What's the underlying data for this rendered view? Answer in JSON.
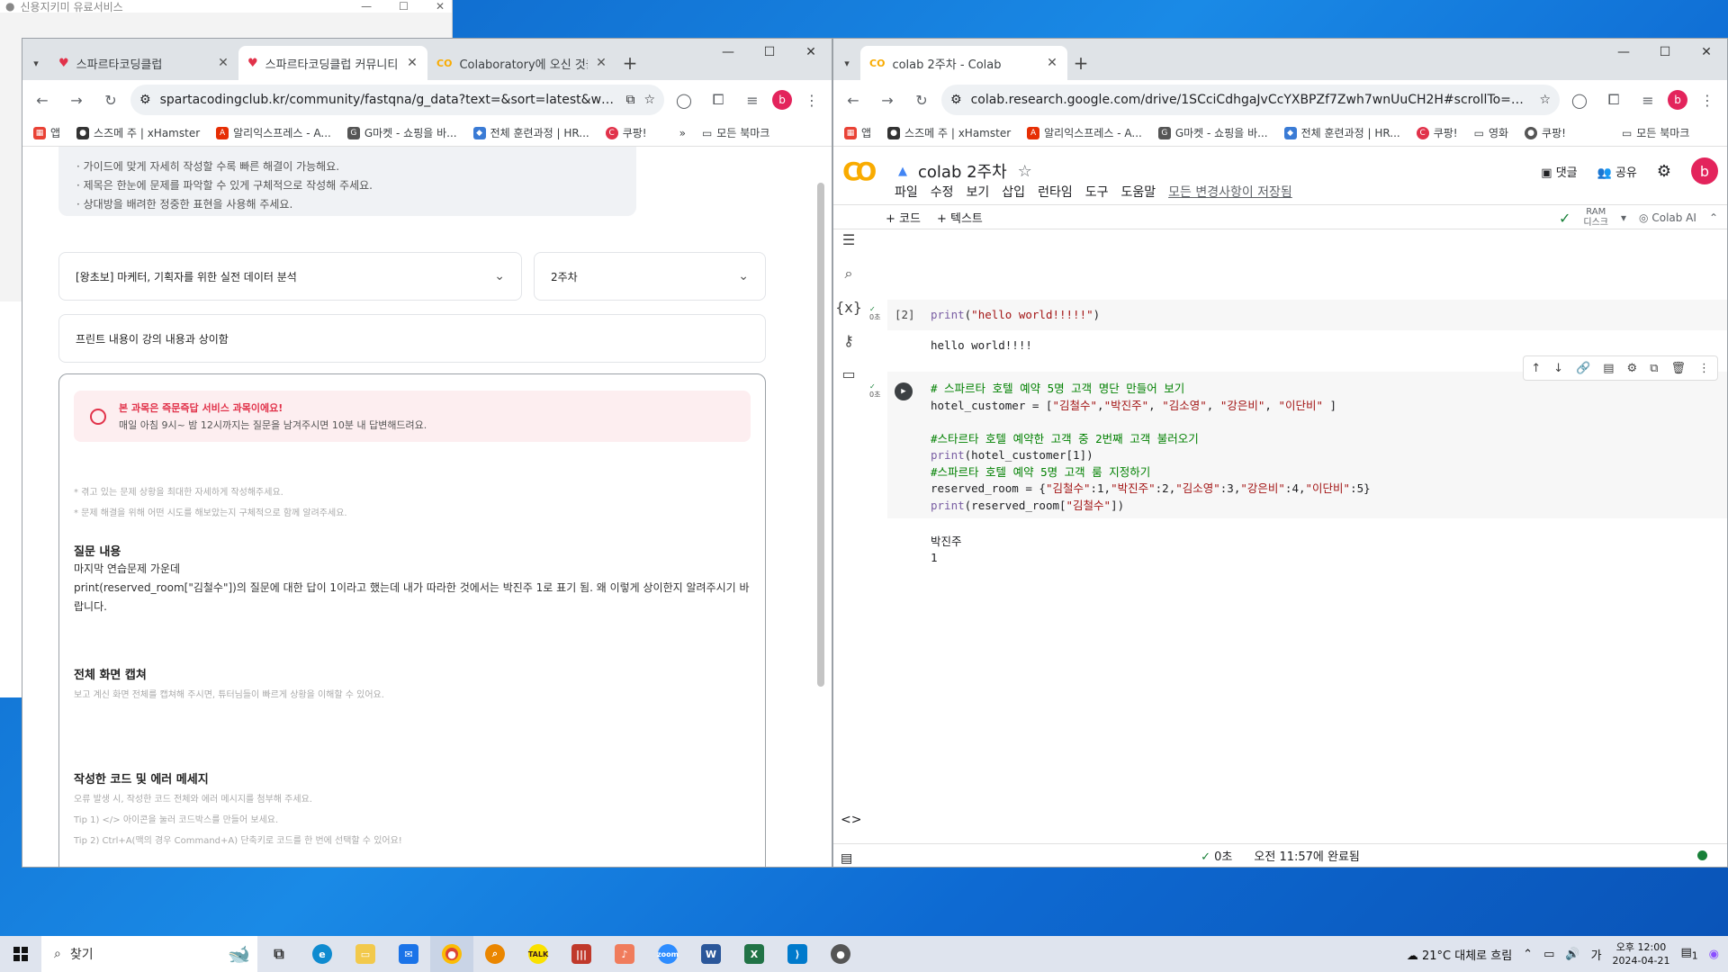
{
  "background_window": {
    "title": "신용지키미 유료서비스"
  },
  "left_browser": {
    "tabs": [
      {
        "label": "스파르타코딩클럽",
        "active": false
      },
      {
        "label": "스파르타코딩클럽 커뮤니티",
        "active": true
      },
      {
        "label": "Colaboratory에 오신 것을",
        "active": false
      }
    ],
    "url": "spartacodingclub.kr/community/fastqna/g_data?text=&sort=latest&wee...",
    "bookmarks": [
      "앱",
      "스즈메 주 | xHamster",
      "알리익스프레스 - A...",
      "G마켓 - 쇼핑을 바...",
      "전체 훈련과정 | HR...",
      "쿠팡!"
    ],
    "bookmarks_more": "»",
    "all_bookmarks": "모든 북마크",
    "guide_lines": [
      "· 가이드에 맞게 자세히 작성할 수록 빠른 해결이 가능해요.",
      "· 제목은 한눈에 문제를 파악할 수 있게 구체적으로 작성해 주세요.",
      "· 상대방을 배려한 정중한 표현을 사용해 주세요."
    ],
    "course_select": "[왕초보] 마케터, 기획자를 위한 실전 데이터 분석",
    "week_select": "2주차",
    "title_value": "프린트 내용이 강의 내용과 상이함",
    "notice_title": "본 과목은 즉문즉답 서비스 과목이에요!",
    "notice_desc": "매일 아침 9시~ 밤 12시까지는 질문을 남겨주시면 10분 내 답변해드려요.",
    "hint1": "* 겪고 있는 문제 상황을 최대한 자세하게 작성해주세요.",
    "hint2": "* 문제 해결을 위해 어떤 시도를 해보았는지 구체적으로 함께 알려주세요.",
    "q_heading": "질문 내용",
    "q_line1": "마지막 연습문제 가운데",
    "q_line2": "print(reserved_room[\"김철수\"])의 질문에 대한 답이 1이라고 했는데 내가 따라한 것에서는 박진주 1로 표기 됨. 왜 이렇게 상이한지 알려주시기 바랍니다.",
    "capture_heading": "전체 화면 캡쳐",
    "capture_hint": "보고 계신 화면 전체를 캡쳐해 주시면, 튜터님들이 빠르게 상황을 이해할 수 있어요.",
    "code_heading": "작성한 코드 및 에러 메세지",
    "code_hint1": "오류 발생 시, 작성한 코드 전체와 에러 메시지를 첨부해 주세요.",
    "code_hint2": "Tip 1) </> 아이콘을 눌러 코드박스를 만들어 보세요.",
    "code_hint3": "Tip 2) Ctrl+A(맥의 경우 Command+A) 단축키로 코드를 한 번에 선택할 수 있어요!"
  },
  "right_browser": {
    "tab": "colab 2주차 - Colab",
    "url": "colab.research.google.com/drive/1SCciCdhgaJvCcYXBPZf7Zwh7wnUuCH2H#scrollTo=Snae6zNS...",
    "bookmarks": [
      "앱",
      "스즈메 주 | xHamster",
      "알리익스프레스 - A...",
      "G마켓 - 쇼핑을 바...",
      "전체 훈련과정 | HR...",
      "쿠팡!",
      "영화",
      "쿠팡!"
    ],
    "all_bookmarks": "모든 북마크",
    "colab": {
      "logo": "CO",
      "notebook_title": "colab 2주차",
      "menu": [
        "파일",
        "수정",
        "보기",
        "삽입",
        "런타임",
        "도구",
        "도움말"
      ],
      "saved_status": "모든 변경사항이 저장됨",
      "comment": "댓글",
      "share": "공유",
      "add_code": "+ 코드",
      "add_text": "+ 텍스트",
      "ram": "RAM",
      "disk": "디스크",
      "colab_ai": "Colab AI",
      "cell1_exec": "[2]",
      "cell1_time": "0초",
      "cell1_code": "print(\"hello world!!!!!\")",
      "cell1_output": "hello world!!!!",
      "cell2_time": "0초",
      "cell2_output_line1": "박진주",
      "cell2_output_line2": "1",
      "status_time": "0초",
      "status_done": "오전 11:57에 완료됨"
    }
  },
  "taskbar": {
    "search_placeholder": "찾기",
    "weather": "21°C  대체로 흐림",
    "ime": "가",
    "time": "오후 12:00",
    "date": "2024-04-21",
    "notif_count": "1"
  }
}
